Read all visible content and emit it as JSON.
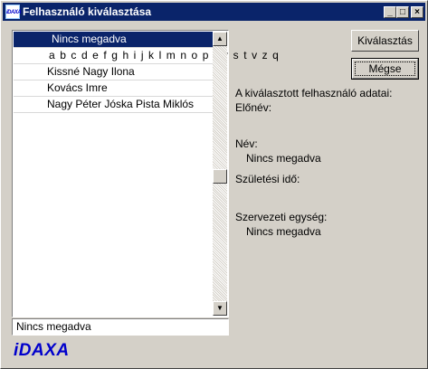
{
  "window": {
    "title": "Felhasználó kiválasztása",
    "icon_name": "idaxa-app-icon",
    "icon_text": "iDAXA",
    "controls": {
      "minimize": "_",
      "maximize": "□",
      "close": "×"
    }
  },
  "list": {
    "items": [
      {
        "label": "Nincs megadva",
        "selected": true
      },
      {
        "label": "a b c d e f g h i j k l m n o p q r s t v z q",
        "selected": false
      },
      {
        "label": "Kissné Nagy Ilona",
        "selected": false
      },
      {
        "label": "Kovács Imre",
        "selected": false
      },
      {
        "label": "Nagy Péter Jóska Pista Miklós",
        "selected": false
      }
    ],
    "scroll_up": "▲",
    "scroll_down": "▼"
  },
  "status_field": {
    "value": "Nincs megadva"
  },
  "buttons": {
    "select": "Kiválasztás",
    "cancel": "Mégse"
  },
  "details": {
    "heading": "A kiválasztott felhasználó adatai:",
    "prefix_label": "Előnév:",
    "prefix_value": "",
    "name_label": "Név:",
    "name_value": "Nincs megadva",
    "birth_label": "Születési idő:",
    "birth_value": "",
    "unit_label": "Szervezeti egység:",
    "unit_value": "Nincs megadva"
  },
  "logo": {
    "text": "iDAXA",
    "color": "#0000cc"
  },
  "colors": {
    "title_bar": "#0a246a",
    "face": "#d4d0c8",
    "selection": "#0a246a"
  }
}
